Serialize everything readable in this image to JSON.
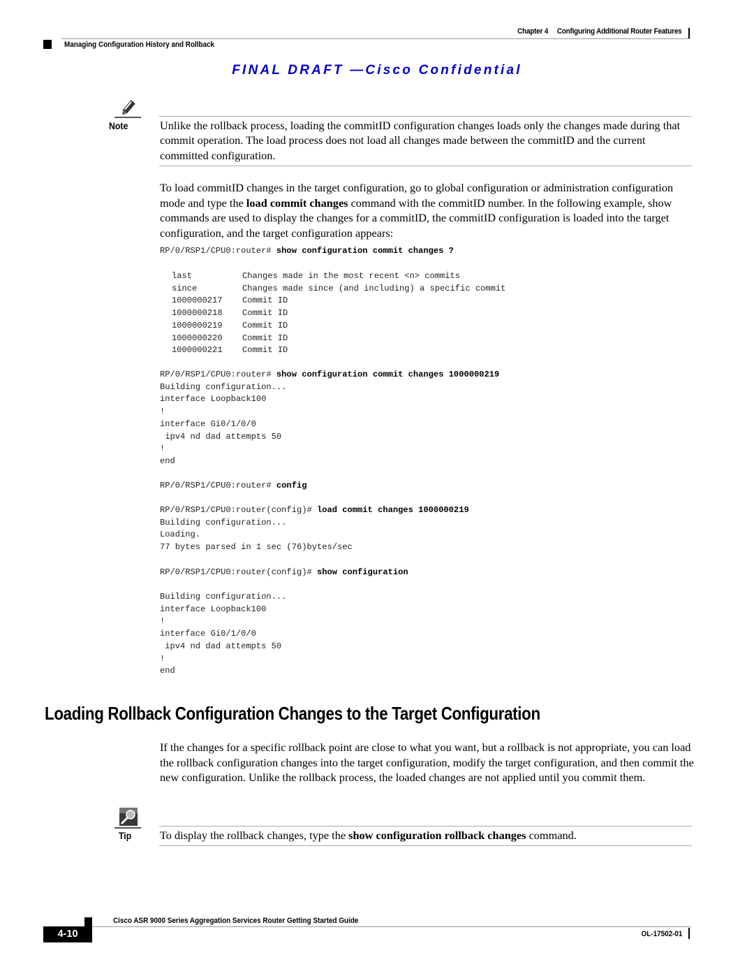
{
  "header": {
    "chapter": "Chapter 4",
    "chapter_title": "Configuring Additional Router Features",
    "section": "Managing Configuration History and Rollback",
    "watermark": "FINAL DRAFT —Cisco Confidential"
  },
  "note": {
    "icon": "pencil-note-icon",
    "label": "Note",
    "text": "Unlike the rollback process, loading the commitID configuration changes loads only the changes made during that commit operation. The load process does not load all changes made between the commitID and the current committed configuration."
  },
  "intro": {
    "text_before": "To load commitID changes in the target configuration, go to global configuration or administration configuration mode and type the ",
    "command": "load commit changes",
    "text_after": " command with the commitID number. In the following example, show commands are used to display the changes for a commitID, the commitID configuration is loaded into the target configuration, and the target configuration appears:"
  },
  "code": {
    "block1": {
      "prompt": "RP/0/RSP1/CPU0:router# ",
      "command": "show configuration commit changes ?"
    },
    "help_rows": [
      {
        "key": "last",
        "desc": "Changes made in the most recent <n> commits"
      },
      {
        "key": "since",
        "desc": "Changes made since (and including) a specific commit"
      },
      {
        "key": "1000000217",
        "desc": "Commit ID"
      },
      {
        "key": "1000000218",
        "desc": "Commit ID"
      },
      {
        "key": "1000000219",
        "desc": "Commit ID"
      },
      {
        "key": "1000000220",
        "desc": "Commit ID"
      },
      {
        "key": "1000000221",
        "desc": "Commit ID"
      }
    ],
    "block2": {
      "prompt": "RP/0/RSP1/CPU0:router# ",
      "command": "show configuration commit changes 1000000219",
      "output": "Building configuration...\ninterface Loopback100\n!\ninterface Gi0/1/0/0\n ipv4 nd dad attempts 50\n!\nend"
    },
    "block3": {
      "prompt": "RP/0/RSP1/CPU0:router# ",
      "command": "config"
    },
    "block4": {
      "prompt": "RP/0/RSP1/CPU0:router(config)# ",
      "command": "load commit changes 1000000219",
      "output": "Building configuration...\nLoading.\n77 bytes parsed in 1 sec (76)bytes/sec"
    },
    "block5": {
      "prompt": "RP/0/RSP1/CPU0:router(config)# ",
      "command": "show configuration"
    },
    "block6": {
      "output": "Building configuration...\ninterface Loopback100\n!\ninterface Gi0/1/0/0\n ipv4 nd dad attempts 50\n!\nend"
    }
  },
  "section2": {
    "heading": "Loading Rollback Configuration Changes to the Target Configuration",
    "text": "If the changes for a specific rollback point are close to what you want, but a rollback is not appropriate, you can load the rollback configuration changes into the target configuration, modify the target configuration, and then commit the new configuration. Unlike the rollback process, the loaded changes are not applied until you commit them."
  },
  "tip": {
    "icon": "magnifier-tip-icon",
    "label": "Tip",
    "text_before": "To display the rollback changes, type the ",
    "command": "show configuration rollback changes",
    "text_after": " command."
  },
  "footer": {
    "title": "Cisco ASR 9000 Series Aggregation Services Router Getting Started Guide",
    "page": "4-10",
    "doc_number": "OL-17502-01"
  }
}
